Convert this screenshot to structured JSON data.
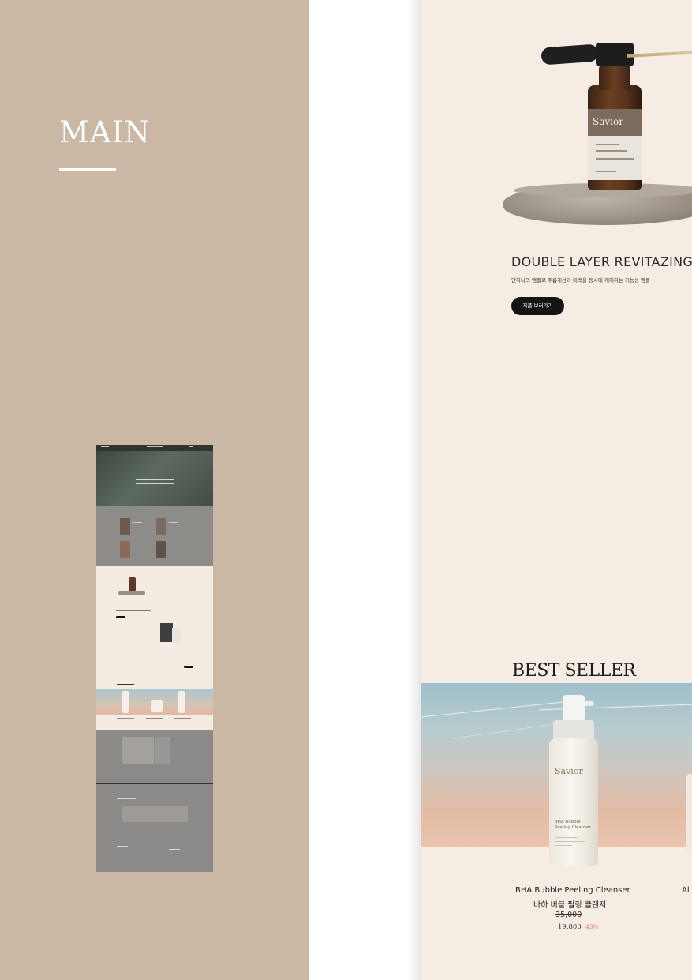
{
  "panel": {
    "title": "MAIN",
    "background": "#cbb8a4"
  },
  "page": {
    "background": "#f5ede3",
    "new_product": {
      "bottle_label_brand": "Savior",
      "title": "DOUBLE LAYER REVITAZING SE",
      "description": "단하나의 앰플로 주름개선과 미백을 동시에 케어하는 기능성 앰플",
      "button_label": "제품 보러가기"
    },
    "best_seller": {
      "title": "BEST SELLER",
      "products": [
        {
          "bottle_brand": "Savior",
          "bottle_name_line1": "BHA Bubble",
          "bottle_name_line2": "Peeling Cleanser",
          "name_en": "BHA Bubble Peeling Cleanser",
          "name_ko": "바하 버블 필링 클렌저",
          "price_original": "35,000",
          "price_sale": "19,800",
          "discount": "43%"
        },
        {
          "name_en": "Al"
        }
      ]
    }
  },
  "icons": [
    "dropper-bottle-image",
    "foam-bottle-image",
    "page-thumbnail"
  ]
}
